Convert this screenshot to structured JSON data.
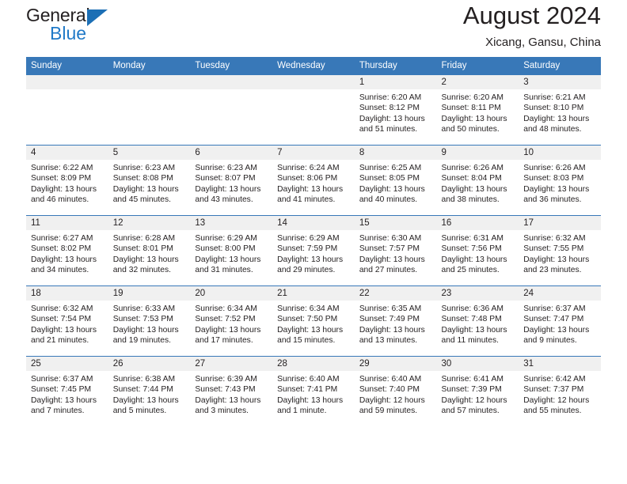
{
  "brand": {
    "name_part1": "General",
    "name_part2": "Blue"
  },
  "header": {
    "title": "August 2024",
    "subtitle": "Xicang, Gansu, China"
  },
  "weekday_headers": [
    "Sunday",
    "Monday",
    "Tuesday",
    "Wednesday",
    "Thursday",
    "Friday",
    "Saturday"
  ],
  "colors": {
    "header_blue": "#3878b8",
    "brand_blue": "#2079c7",
    "cell_band": "#f0f0f0",
    "text": "#231f20"
  },
  "weeks": [
    [
      {
        "day": "",
        "sunrise": "",
        "sunset": "",
        "daylight1": "",
        "daylight2": ""
      },
      {
        "day": "",
        "sunrise": "",
        "sunset": "",
        "daylight1": "",
        "daylight2": ""
      },
      {
        "day": "",
        "sunrise": "",
        "sunset": "",
        "daylight1": "",
        "daylight2": ""
      },
      {
        "day": "",
        "sunrise": "",
        "sunset": "",
        "daylight1": "",
        "daylight2": ""
      },
      {
        "day": "1",
        "sunrise": "Sunrise: 6:20 AM",
        "sunset": "Sunset: 8:12 PM",
        "daylight1": "Daylight: 13 hours",
        "daylight2": "and 51 minutes."
      },
      {
        "day": "2",
        "sunrise": "Sunrise: 6:20 AM",
        "sunset": "Sunset: 8:11 PM",
        "daylight1": "Daylight: 13 hours",
        "daylight2": "and 50 minutes."
      },
      {
        "day": "3",
        "sunrise": "Sunrise: 6:21 AM",
        "sunset": "Sunset: 8:10 PM",
        "daylight1": "Daylight: 13 hours",
        "daylight2": "and 48 minutes."
      }
    ],
    [
      {
        "day": "4",
        "sunrise": "Sunrise: 6:22 AM",
        "sunset": "Sunset: 8:09 PM",
        "daylight1": "Daylight: 13 hours",
        "daylight2": "and 46 minutes."
      },
      {
        "day": "5",
        "sunrise": "Sunrise: 6:23 AM",
        "sunset": "Sunset: 8:08 PM",
        "daylight1": "Daylight: 13 hours",
        "daylight2": "and 45 minutes."
      },
      {
        "day": "6",
        "sunrise": "Sunrise: 6:23 AM",
        "sunset": "Sunset: 8:07 PM",
        "daylight1": "Daylight: 13 hours",
        "daylight2": "and 43 minutes."
      },
      {
        "day": "7",
        "sunrise": "Sunrise: 6:24 AM",
        "sunset": "Sunset: 8:06 PM",
        "daylight1": "Daylight: 13 hours",
        "daylight2": "and 41 minutes."
      },
      {
        "day": "8",
        "sunrise": "Sunrise: 6:25 AM",
        "sunset": "Sunset: 8:05 PM",
        "daylight1": "Daylight: 13 hours",
        "daylight2": "and 40 minutes."
      },
      {
        "day": "9",
        "sunrise": "Sunrise: 6:26 AM",
        "sunset": "Sunset: 8:04 PM",
        "daylight1": "Daylight: 13 hours",
        "daylight2": "and 38 minutes."
      },
      {
        "day": "10",
        "sunrise": "Sunrise: 6:26 AM",
        "sunset": "Sunset: 8:03 PM",
        "daylight1": "Daylight: 13 hours",
        "daylight2": "and 36 minutes."
      }
    ],
    [
      {
        "day": "11",
        "sunrise": "Sunrise: 6:27 AM",
        "sunset": "Sunset: 8:02 PM",
        "daylight1": "Daylight: 13 hours",
        "daylight2": "and 34 minutes."
      },
      {
        "day": "12",
        "sunrise": "Sunrise: 6:28 AM",
        "sunset": "Sunset: 8:01 PM",
        "daylight1": "Daylight: 13 hours",
        "daylight2": "and 32 minutes."
      },
      {
        "day": "13",
        "sunrise": "Sunrise: 6:29 AM",
        "sunset": "Sunset: 8:00 PM",
        "daylight1": "Daylight: 13 hours",
        "daylight2": "and 31 minutes."
      },
      {
        "day": "14",
        "sunrise": "Sunrise: 6:29 AM",
        "sunset": "Sunset: 7:59 PM",
        "daylight1": "Daylight: 13 hours",
        "daylight2": "and 29 minutes."
      },
      {
        "day": "15",
        "sunrise": "Sunrise: 6:30 AM",
        "sunset": "Sunset: 7:57 PM",
        "daylight1": "Daylight: 13 hours",
        "daylight2": "and 27 minutes."
      },
      {
        "day": "16",
        "sunrise": "Sunrise: 6:31 AM",
        "sunset": "Sunset: 7:56 PM",
        "daylight1": "Daylight: 13 hours",
        "daylight2": "and 25 minutes."
      },
      {
        "day": "17",
        "sunrise": "Sunrise: 6:32 AM",
        "sunset": "Sunset: 7:55 PM",
        "daylight1": "Daylight: 13 hours",
        "daylight2": "and 23 minutes."
      }
    ],
    [
      {
        "day": "18",
        "sunrise": "Sunrise: 6:32 AM",
        "sunset": "Sunset: 7:54 PM",
        "daylight1": "Daylight: 13 hours",
        "daylight2": "and 21 minutes."
      },
      {
        "day": "19",
        "sunrise": "Sunrise: 6:33 AM",
        "sunset": "Sunset: 7:53 PM",
        "daylight1": "Daylight: 13 hours",
        "daylight2": "and 19 minutes."
      },
      {
        "day": "20",
        "sunrise": "Sunrise: 6:34 AM",
        "sunset": "Sunset: 7:52 PM",
        "daylight1": "Daylight: 13 hours",
        "daylight2": "and 17 minutes."
      },
      {
        "day": "21",
        "sunrise": "Sunrise: 6:34 AM",
        "sunset": "Sunset: 7:50 PM",
        "daylight1": "Daylight: 13 hours",
        "daylight2": "and 15 minutes."
      },
      {
        "day": "22",
        "sunrise": "Sunrise: 6:35 AM",
        "sunset": "Sunset: 7:49 PM",
        "daylight1": "Daylight: 13 hours",
        "daylight2": "and 13 minutes."
      },
      {
        "day": "23",
        "sunrise": "Sunrise: 6:36 AM",
        "sunset": "Sunset: 7:48 PM",
        "daylight1": "Daylight: 13 hours",
        "daylight2": "and 11 minutes."
      },
      {
        "day": "24",
        "sunrise": "Sunrise: 6:37 AM",
        "sunset": "Sunset: 7:47 PM",
        "daylight1": "Daylight: 13 hours",
        "daylight2": "and 9 minutes."
      }
    ],
    [
      {
        "day": "25",
        "sunrise": "Sunrise: 6:37 AM",
        "sunset": "Sunset: 7:45 PM",
        "daylight1": "Daylight: 13 hours",
        "daylight2": "and 7 minutes."
      },
      {
        "day": "26",
        "sunrise": "Sunrise: 6:38 AM",
        "sunset": "Sunset: 7:44 PM",
        "daylight1": "Daylight: 13 hours",
        "daylight2": "and 5 minutes."
      },
      {
        "day": "27",
        "sunrise": "Sunrise: 6:39 AM",
        "sunset": "Sunset: 7:43 PM",
        "daylight1": "Daylight: 13 hours",
        "daylight2": "and 3 minutes."
      },
      {
        "day": "28",
        "sunrise": "Sunrise: 6:40 AM",
        "sunset": "Sunset: 7:41 PM",
        "daylight1": "Daylight: 13 hours",
        "daylight2": "and 1 minute."
      },
      {
        "day": "29",
        "sunrise": "Sunrise: 6:40 AM",
        "sunset": "Sunset: 7:40 PM",
        "daylight1": "Daylight: 12 hours",
        "daylight2": "and 59 minutes."
      },
      {
        "day": "30",
        "sunrise": "Sunrise: 6:41 AM",
        "sunset": "Sunset: 7:39 PM",
        "daylight1": "Daylight: 12 hours",
        "daylight2": "and 57 minutes."
      },
      {
        "day": "31",
        "sunrise": "Sunrise: 6:42 AM",
        "sunset": "Sunset: 7:37 PM",
        "daylight1": "Daylight: 12 hours",
        "daylight2": "and 55 minutes."
      }
    ]
  ]
}
